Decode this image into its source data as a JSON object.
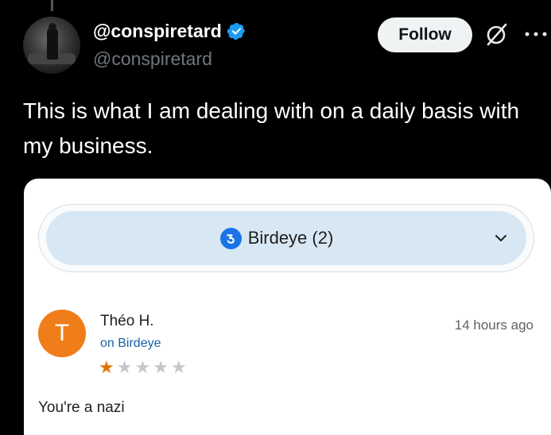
{
  "author": {
    "display_name": "@conspiretard",
    "handle": "@conspiretard",
    "verified": true
  },
  "actions": {
    "follow_label": "Follow",
    "icons": [
      "grok-icon",
      "more-icon"
    ]
  },
  "tweet": {
    "text": "This is what I am dealing with on a daily basis with my business."
  },
  "embedded_review": {
    "source_selector": {
      "label": "Birdeye (2)",
      "icon": "birdeye-icon"
    },
    "reviewer": {
      "initial": "T",
      "name": "Théo H.",
      "source": "on Birdeye",
      "time": "14 hours ago",
      "rating": 1,
      "rating_max": 5,
      "text": "You're a nazi"
    }
  },
  "colors": {
    "background": "#000000",
    "follow_button": "#eff3f4",
    "verified_badge": "#1d9bf0",
    "pill": "#d7e7f4",
    "reviewer_avatar": "#ef7d1a",
    "star_on": "#e37400",
    "star_off": "#c5c7ca",
    "source_link": "#1a5fa8"
  }
}
